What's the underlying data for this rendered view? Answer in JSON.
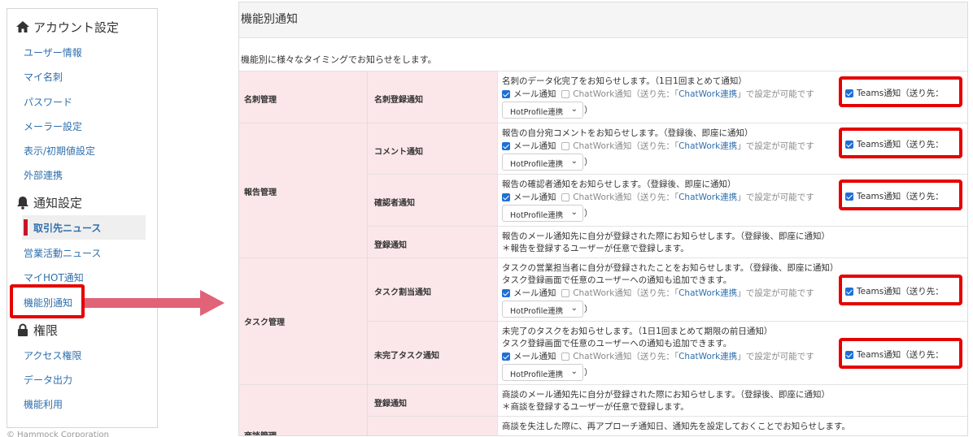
{
  "sidebar": {
    "account_heading": "アカウント設定",
    "account_items": [
      "ユーザー情報",
      "マイ名刺",
      "パスワード",
      "メーラー設定",
      "表示/初期値設定",
      "外部連携"
    ],
    "notify_heading": "通知設定",
    "notify_active": "取引先ニュース",
    "notify_items": [
      "営業活動ニュース",
      "マイHOT通知",
      "機能別通知"
    ],
    "perm_heading": "権限",
    "perm_items": [
      "アクセス権限",
      "データ出力",
      "機能利用"
    ],
    "footer": "© Hammock Corporation"
  },
  "panel": {
    "title": "機能別通知",
    "description": "機能別に様々なタイミングでお知らせをします。"
  },
  "categories": [
    "名刺管理",
    "報告管理",
    "タスク管理",
    "商談管理"
  ],
  "subs": [
    "名刺登録通知",
    "コメント通知",
    "確認者通知",
    "登録通知",
    "タスク割当通知",
    "未完了タスク通知",
    "登録通知"
  ],
  "rows": [
    {
      "desc": [
        "名刺のデータ化完了をお知らせします。（1日1回まとめて通知）"
      ]
    },
    {
      "desc": [
        "報告の自分宛コメントをお知らせします。（登録後、即座に通知）"
      ]
    },
    {
      "desc": [
        "報告の確認者通知をお知らせします。（登録後、即座に通知）"
      ]
    },
    {
      "desc": [
        "報告のメール通知先に自分が登録された際にお知らせします。（登録後、即座に通知）",
        "＊報告を登録するユーザーが任意で登録します。"
      ]
    },
    {
      "desc": [
        "タスクの営業担当者に自分が登録されたことをお知らせします。（登録後、即座に通知）",
        "タスク登録画面で任意のユーザーへの通知も追加できます。"
      ]
    },
    {
      "desc": [
        "未完了のタスクをお知らせします。（1日1回まとめて期限の前日通知）",
        "タスク登録画面で任意のユーザーへの通知も追加できます。"
      ]
    },
    {
      "desc": [
        "商談のメール通知先に自分が登録された際にお知らせします。（登録後、即座に通知）",
        "＊商談を登録するユーザーが任意で登録します。"
      ]
    },
    {
      "desc": [
        "商談を失注した際に、再アプローチ通知日、通知先を設定しておくことでお知らせします。"
      ]
    }
  ],
  "options": {
    "mail": "メール通知",
    "chatwork_pre": "ChatWork通知（送り先：「",
    "chatwork_link": "ChatWork連携",
    "chatwork_post": "」で設定が可能です",
    "close_paren": "）",
    "teams": "Teams通知（送り先：",
    "select_value": "HotProfile連携"
  },
  "colors": {
    "highlight": "#e60000",
    "arrow": "#e06377",
    "category_bg": "#fbe7e9",
    "link": "#2f6fad",
    "checkbox": "#1f70d6"
  }
}
